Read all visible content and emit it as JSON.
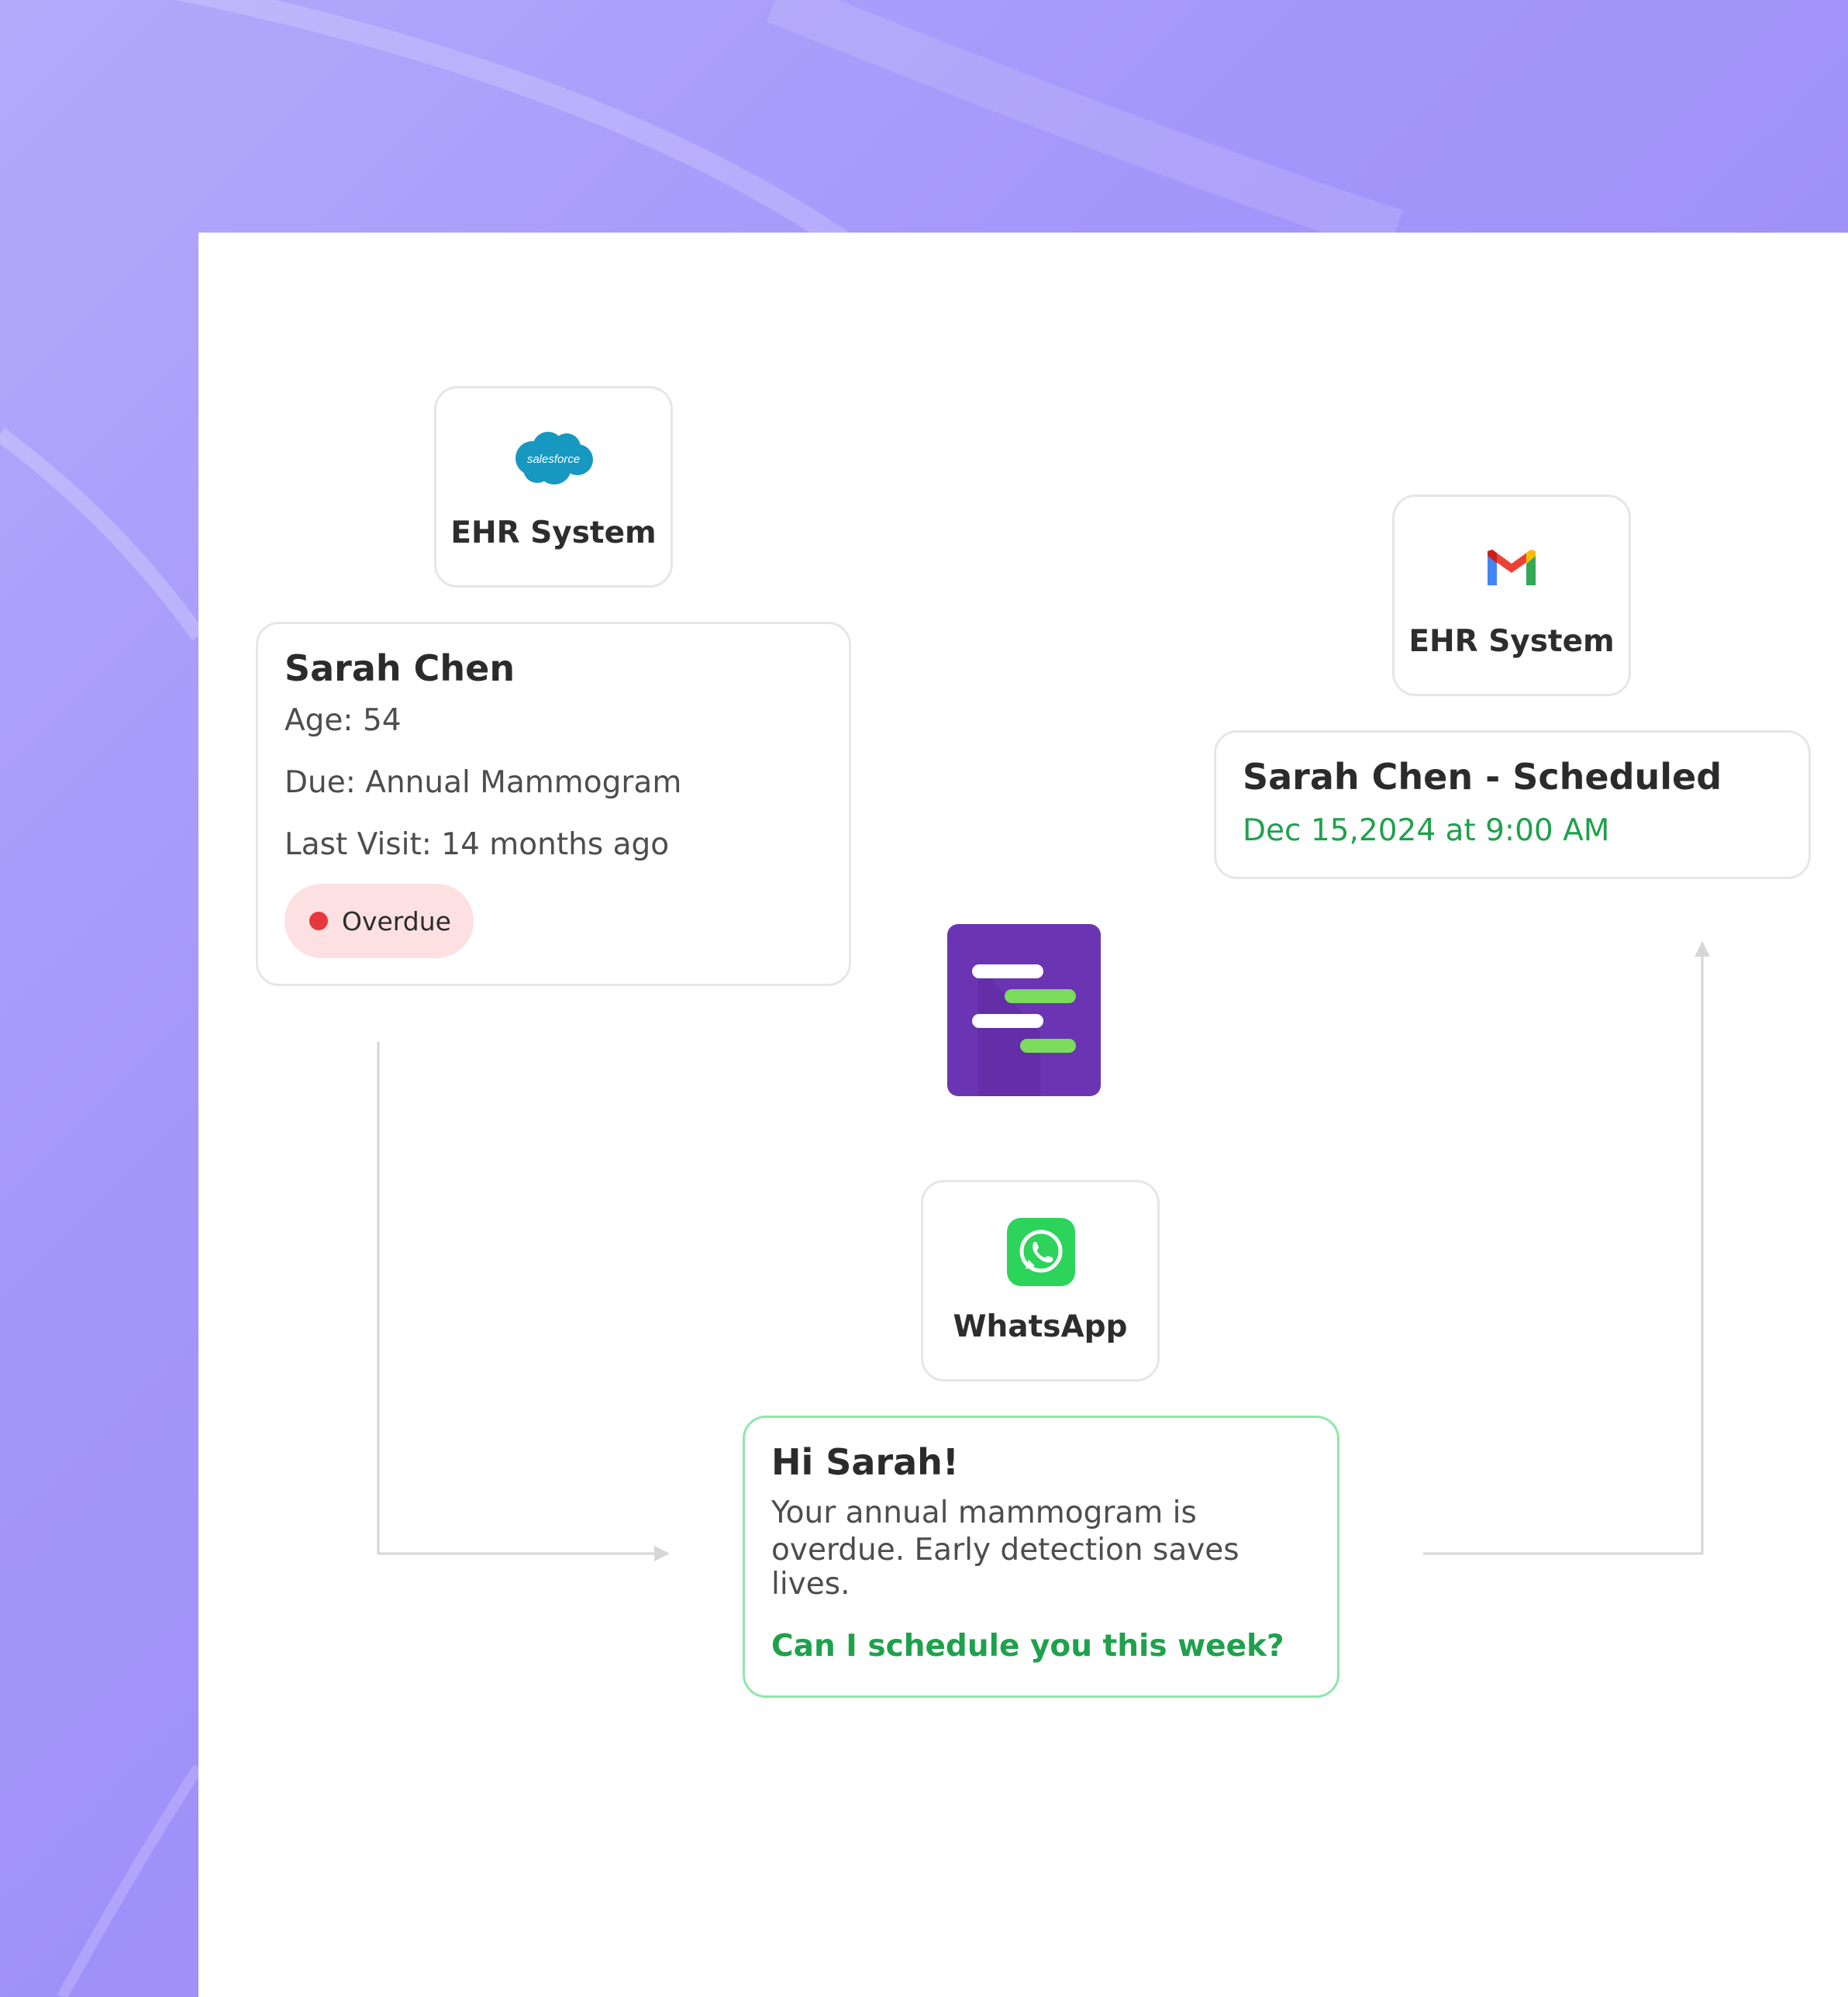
{
  "nodes": {
    "salesforce": {
      "logo_text": "salesforce",
      "label": "EHR System",
      "icon": "salesforce-cloud-icon"
    },
    "gmail": {
      "label": "EHR System",
      "icon": "gmail-icon"
    },
    "whatsapp": {
      "label": "WhatsApp",
      "icon": "whatsapp-icon"
    },
    "hub": {
      "icon": "app-logo-icon"
    }
  },
  "patient_card": {
    "name": "Sarah Chen",
    "age": "Age: 54",
    "due": "Due: Annual Mammogram",
    "last_visit": "Last Visit: 14 months ago",
    "status": "Overdue"
  },
  "scheduled_card": {
    "title": "Sarah Chen - Scheduled",
    "datetime": "Dec 15,2024 at 9:00 AM"
  },
  "message_card": {
    "greeting": "Hi Sarah!",
    "body_line1": "Your annual mammogram is",
    "body_line2": "overdue. Early detection saves",
    "body_line3": "lives.",
    "question": "Can I schedule you this week?"
  },
  "colors": {
    "background": "#a596fa",
    "accent_green": "#1fa14c",
    "hub_purple": "#6b34b3",
    "status_red": "#e8373c",
    "status_bg": "#fde0e2"
  }
}
